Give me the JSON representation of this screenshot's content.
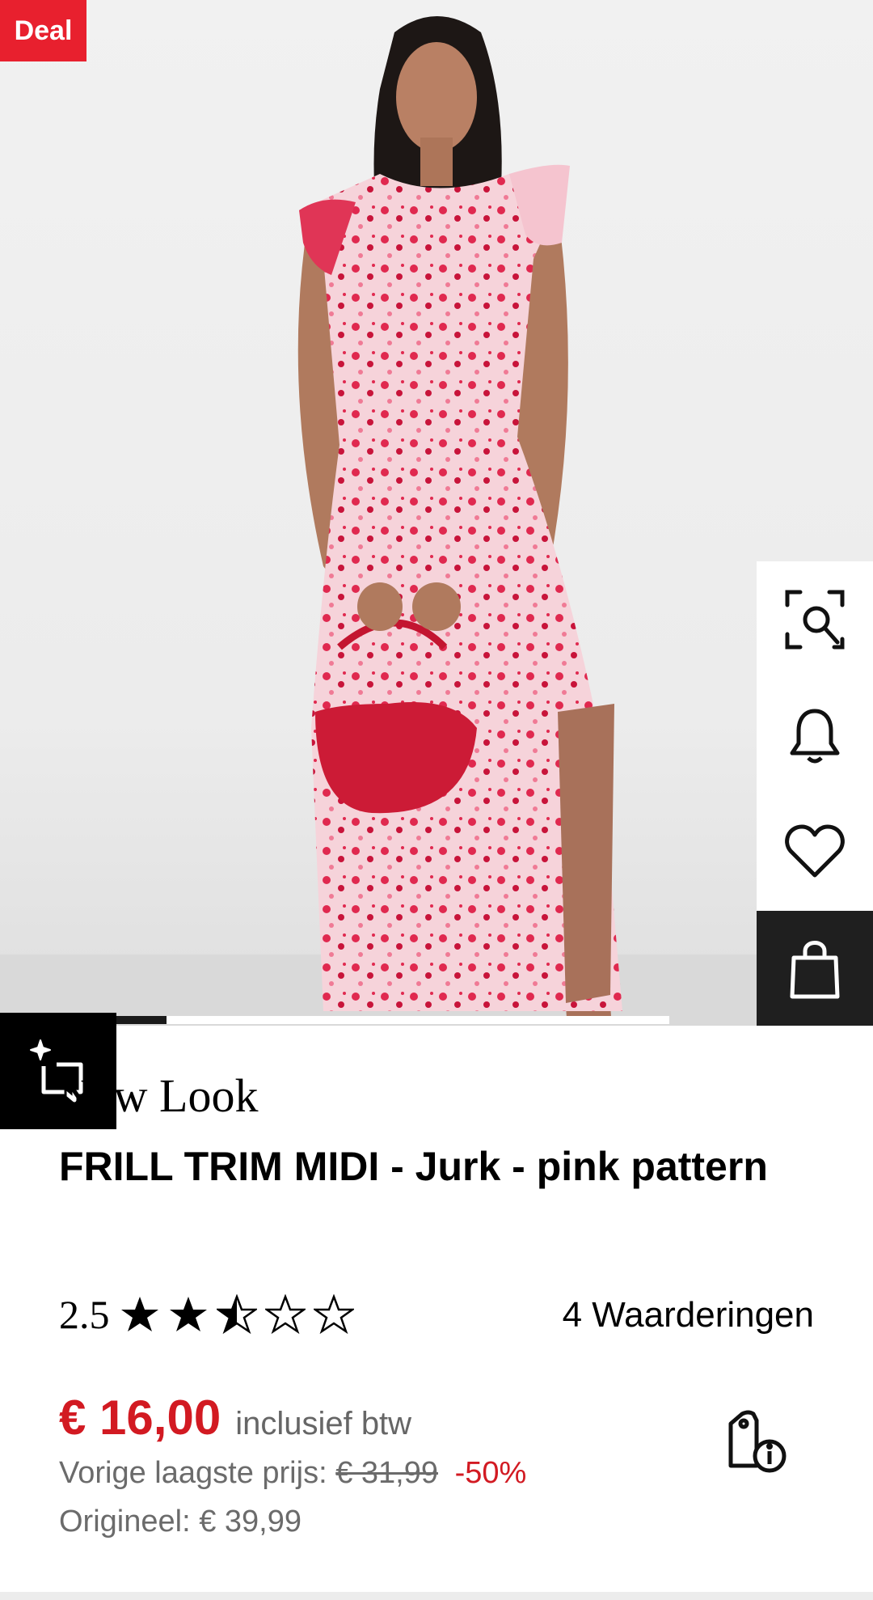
{
  "badge": {
    "label": "Deal"
  },
  "actions": {
    "visual_search_icon": "visual-search-icon",
    "notify_icon": "bell-icon",
    "wishlist_icon": "heart-icon",
    "cart_icon": "shopping-bag-icon"
  },
  "gallery": {
    "active_index": 0
  },
  "product": {
    "brand": "New Look",
    "title": "FRILL TRIM MIDI - Jurk - pink pattern",
    "rating": {
      "value": "2.5",
      "stars_filled": 2.5,
      "stars_total": 5,
      "reviews_label": "4 Waarderingen"
    },
    "price": {
      "current": "€ 16,00",
      "vat_note": "inclusief btw",
      "previous_label": "Vorige laagste prijs:",
      "previous_value": "€ 31,99",
      "discount": "-50%",
      "original_label": "Origineel: € 39,99"
    }
  },
  "colors": {
    "accent": "#d21a22",
    "badge": "#e8202e",
    "dark": "#1f1f1f"
  }
}
